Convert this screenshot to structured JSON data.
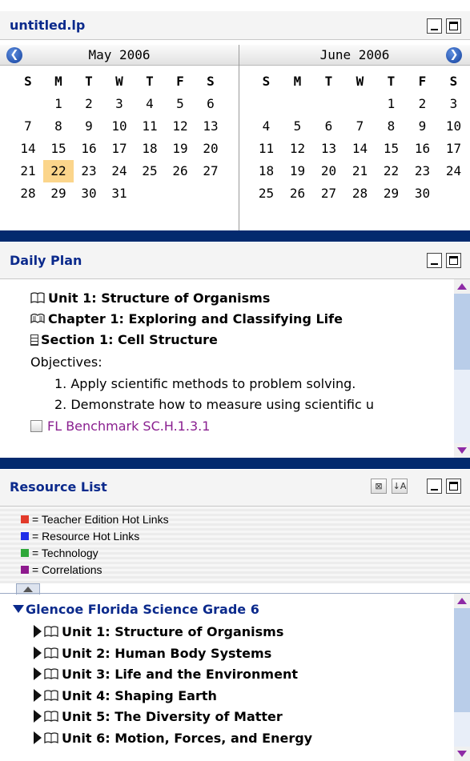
{
  "window": {
    "title": "untitled.lp"
  },
  "calendar": {
    "weekday_headers": [
      "S",
      "M",
      "T",
      "W",
      "T",
      "F",
      "S"
    ],
    "left": {
      "month": "May 2006",
      "days": [
        "",
        "1",
        "2",
        "3",
        "4",
        "5",
        "6",
        "7",
        "8",
        "9",
        "10",
        "11",
        "12",
        "13",
        "14",
        "15",
        "16",
        "17",
        "18",
        "19",
        "20",
        "21",
        "22",
        "23",
        "24",
        "25",
        "26",
        "27",
        "28",
        "29",
        "30",
        "31",
        "",
        "",
        ""
      ],
      "today": "22"
    },
    "right": {
      "month": "June 2006",
      "days": [
        "",
        "",
        "",
        "",
        "1",
        "2",
        "3",
        "4",
        "5",
        "6",
        "7",
        "8",
        "9",
        "10",
        "11",
        "12",
        "13",
        "14",
        "15",
        "16",
        "17",
        "18",
        "19",
        "20",
        "21",
        "22",
        "23",
        "24",
        "25",
        "26",
        "27",
        "28",
        "29",
        "30",
        ""
      ]
    },
    "prev_icon": "arrow-left-icon",
    "next_icon": "arrow-right-icon",
    "today_color": "#fbd58b"
  },
  "daily_plan": {
    "title": "Daily Plan",
    "unit": "Unit 1:  Structure of Organisms",
    "chapter": "Chapter 1: Exploring and Classifying Life",
    "section": "Section 1: Cell Structure",
    "objectives_label": "Objectives:",
    "objectives": [
      "1. Apply scientific methods to problem solving.",
      "2. Demonstrate how to measure using scientific u"
    ],
    "benchmark": "FL Benchmark SC.H.1.3.1"
  },
  "resource_list": {
    "title": "Resource List",
    "legend": [
      {
        "label": "= Teacher Edition Hot Links",
        "color": "#e23a2a"
      },
      {
        "label": "= Resource Hot Links",
        "color": "#1f2ee8"
      },
      {
        "label": "= Technology",
        "color": "#2fa83a"
      },
      {
        "label": "= Correlations",
        "color": "#8e1a8e"
      }
    ],
    "root": "Glencoe Florida Science Grade 6",
    "units": [
      "Unit 1:  Structure of Organisms",
      "Unit 2:  Human Body Systems",
      "Unit 3:  Life and the Environment",
      "Unit 4:  Shaping Earth",
      "Unit 5:  The Diversity of Matter",
      "Unit 6: Motion, Forces, and Energy"
    ]
  },
  "colors": {
    "title_text": "#0b2a8c",
    "separator": "#032a6e",
    "link": "#8a2090",
    "scroll_arrow": "#8e2aa6"
  }
}
